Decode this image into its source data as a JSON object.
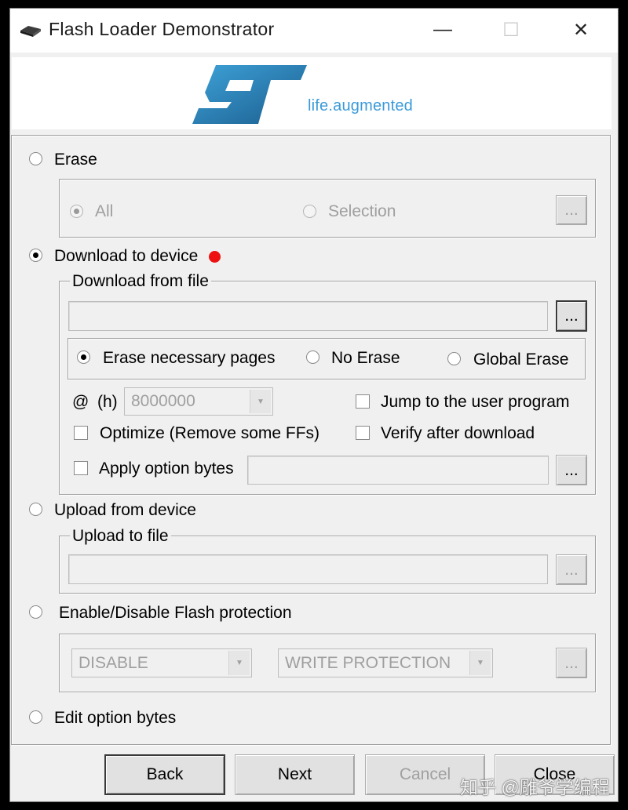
{
  "window": {
    "title": "Flash Loader Demonstrator",
    "minimize_glyph": "—",
    "maximize_glyph": "☐",
    "close_glyph": "✕"
  },
  "banner": {
    "tagline": "life.augmented"
  },
  "erase": {
    "label": "Erase",
    "all_label": "All",
    "selection_label": "Selection",
    "browse_label": "..."
  },
  "download": {
    "label": "Download to device",
    "group_label": "Download from file",
    "file_value": "",
    "browse_label": "...",
    "erase_necessary_label": "Erase necessary pages",
    "no_erase_label": "No Erase",
    "global_erase_label": "Global Erase",
    "at_label": "@",
    "h_label": "(h)",
    "address_value": "8000000",
    "jump_label": "Jump to the user program",
    "optimize_label": "Optimize (Remove some FFs)",
    "verify_label": "Verify after download",
    "apply_option_label": "Apply option bytes",
    "option_file_value": "",
    "option_browse_label": "..."
  },
  "upload": {
    "label": "Upload from device",
    "group_label": "Upload to file",
    "file_value": "",
    "browse_label": "..."
  },
  "protection": {
    "label": "Enable/Disable Flash protection",
    "mode_value": "DISABLE",
    "type_value": "WRITE PROTECTION",
    "browse_label": "..."
  },
  "edit_option": {
    "label": "Edit option bytes"
  },
  "footer": {
    "back_label": "Back",
    "next_label": "Next",
    "cancel_label": "Cancel",
    "close_label": "Close"
  },
  "watermark": {
    "text": "知乎 @雕爷学编程"
  },
  "colors": {
    "accent_blue": "#3a9ad9",
    "red_marker": "#ee1111",
    "logo_blue": "#1f5f8f"
  }
}
